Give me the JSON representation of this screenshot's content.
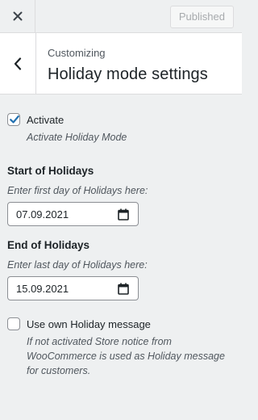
{
  "header": {
    "close_icon": "close-icon",
    "publish_label": "Published"
  },
  "section": {
    "back_icon": "chevron-left-icon",
    "breadcrumb": "Customizing",
    "title": "Holiday mode settings"
  },
  "activate": {
    "checked": true,
    "label": "Activate",
    "description": "Activate Holiday Mode"
  },
  "start": {
    "title": "Start of Holidays",
    "description": "Enter first day of Holidays here:",
    "value": "07.09.2021",
    "icon": "calendar-icon"
  },
  "end": {
    "title": "End of Holidays",
    "description": "Enter last day of Holidays here:",
    "value": "15.09.2021",
    "icon": "calendar-icon"
  },
  "own_message": {
    "checked": false,
    "label": "Use own Holiday message",
    "description": "If not activated Store notice from WooCommerce is used as Holiday message for customers."
  },
  "colors": {
    "checkbox_accent": "#2271b1",
    "panel_background": "#eef0f1"
  }
}
